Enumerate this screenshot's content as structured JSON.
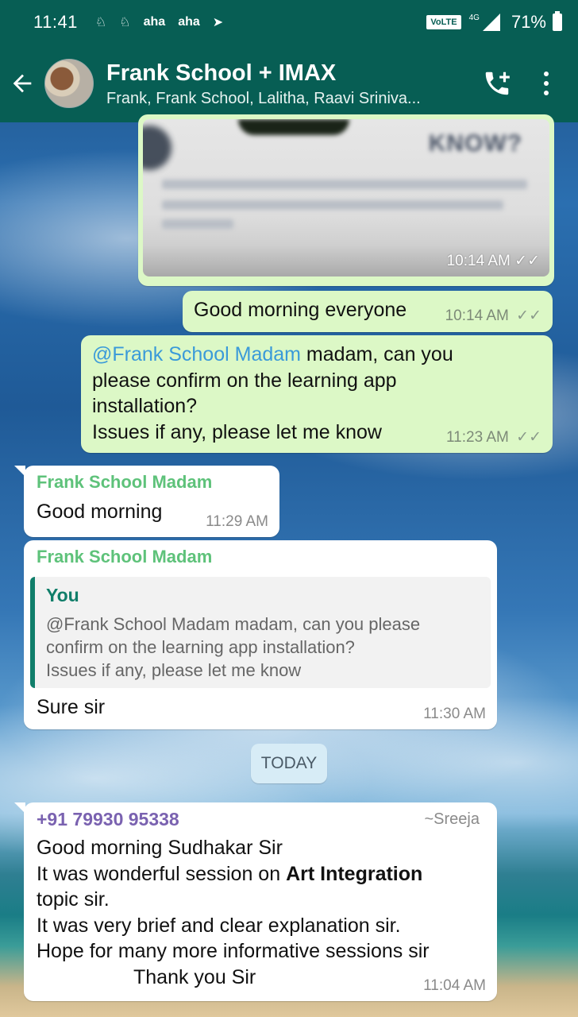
{
  "status_bar": {
    "time": "11:41",
    "notifications": [
      "aha",
      "aha"
    ],
    "volte": "VoLTE",
    "network": "4G",
    "battery": "71%"
  },
  "header": {
    "title": "Frank School + IMAX",
    "subtitle": "Frank, Frank School, Lalitha, Raavi Sriniva..."
  },
  "messages": {
    "image": {
      "time": "10:14 AM"
    },
    "good_morning": {
      "text": "Good morning everyone",
      "time": "10:14 AM"
    },
    "confirm": {
      "mention": "@Frank School Madam",
      "line1_rest": " madam, can you",
      "line2": "please confirm on the learning app",
      "line3": "installation?",
      "line4": "Issues if any, please let me know",
      "time": "11:23 AM"
    },
    "reply1": {
      "sender": "Frank School Madam",
      "text": "Good morning",
      "time": "11:29 AM"
    },
    "reply2": {
      "sender": "Frank School Madam",
      "quote_author": "You",
      "quote_line1": "@Frank School Madam madam, can you please",
      "quote_line2": "confirm on the learning app installation?",
      "quote_line3": "Issues if any, please let me know",
      "text": "Sure sir",
      "time": "11:30 AM"
    },
    "date_chip": "TODAY",
    "sreeja": {
      "phone": "+91 79930 95338",
      "name": "~Sreeja",
      "line1": "Good morning Sudhakar Sir",
      "line2_a": "It was wonderful session on ",
      "line2_b": "Art Integration",
      "line3": "topic sir.",
      "line4": "It was very brief and clear explanation sir.",
      "line5": "Hope for many more informative sessions sir",
      "line6": "Thank you Sir",
      "time": "11:04 AM"
    }
  },
  "colors": {
    "header": "#075e54",
    "outgoing": "#dcf8c6",
    "incoming": "#ffffff",
    "sender_green": "#5ec27a",
    "mention_blue": "#3a9ad9",
    "phone_purple": "#7a62b0"
  }
}
